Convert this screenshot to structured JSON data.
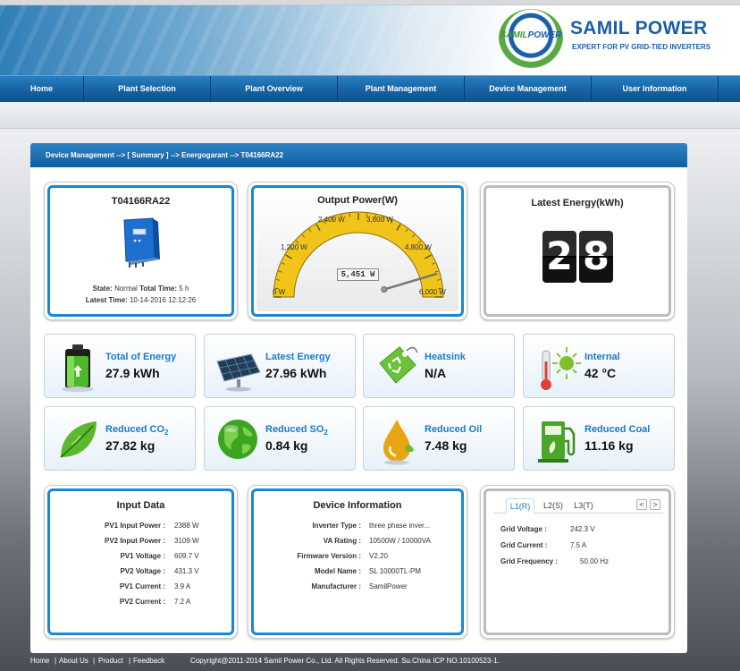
{
  "brand": {
    "circle_text_a": "SAMIL",
    "circle_text_b": "POWER",
    "title": "SAMIL POWER",
    "subtitle": "EXPERT FOR PV GRID-TIED INVERTERS"
  },
  "nav": {
    "items": [
      {
        "label": "Home"
      },
      {
        "label": "Plant Selection"
      },
      {
        "label": "Plant Overview"
      },
      {
        "label": "Plant Management"
      },
      {
        "label": "Device Management"
      },
      {
        "label": "User Information"
      }
    ]
  },
  "breadcrumb": "Device Management --> [ Summary ] --> Energogarant --> T04166RA22",
  "device": {
    "title": "T04166RA22",
    "state_label": "State:",
    "state_value": "Normal",
    "total_time_label": "Total Time:",
    "total_time_value": "5 h",
    "latest_time_label": "Latest Time:",
    "latest_time_value": "10-14-2016 12:12:26"
  },
  "output_power": {
    "title": "Output Power(W)",
    "value_text": "5,451 W",
    "value": 5451,
    "max": 6000,
    "ticks": [
      "0 W",
      "1,200 W",
      "2,400 W",
      "3,600 W",
      "4,800 W",
      "6,000 W"
    ]
  },
  "latest_energy": {
    "title": "Latest Energy(kWh)",
    "digits": [
      "2",
      "8"
    ]
  },
  "stats": [
    {
      "label": "Total of Energy",
      "value": "27.9 kWh",
      "icon": "battery-icon"
    },
    {
      "label": "Latest Energy",
      "value": "27.96 kWh",
      "icon": "solar-panel-icon"
    },
    {
      "label": "Heatsink",
      "value": "N/A",
      "icon": "recycle-tag-icon"
    },
    {
      "label": "Internal",
      "value": "42 °C",
      "icon": "thermometer-sun-icon"
    },
    {
      "label": "Reduced CO",
      "sub": "2",
      "value": "27.82 kg",
      "icon": "leaf-icon"
    },
    {
      "label": "Reduced SO",
      "sub": "2",
      "value": "0.84 kg",
      "icon": "globe-icon"
    },
    {
      "label": "Reduced Oil",
      "value": "7.48 kg",
      "icon": "oil-drop-icon"
    },
    {
      "label": "Reduced Coal",
      "value": "11.16 kg",
      "icon": "fuel-pump-icon"
    }
  ],
  "input_data": {
    "title": "Input Data",
    "rows": [
      {
        "label": "PV1 Input Power :",
        "value": "2388 W"
      },
      {
        "label": "PV2 Input Power :",
        "value": "3109 W"
      },
      {
        "label": "PV1 Voltage :",
        "value": "609.7 V"
      },
      {
        "label": "PV2 Voltage :",
        "value": "431.3 V"
      },
      {
        "label": "PV1 Current :",
        "value": "3.9 A"
      },
      {
        "label": "PV2 Current :",
        "value": "7.2 A"
      }
    ]
  },
  "device_info": {
    "title": "Device Information",
    "rows": [
      {
        "label": "Inverter Type :",
        "value": "three phase inver..."
      },
      {
        "label": "VA Rating :",
        "value": "10500W / 10000VA"
      },
      {
        "label": "Firmware Version :",
        "value": "V2.20"
      },
      {
        "label": "Model Name :",
        "value": "SL 10000TL-PM"
      },
      {
        "label": "Manufacturer :",
        "value": "SamilPower"
      }
    ]
  },
  "grid": {
    "tabs": [
      "L1(R)",
      "L2(S)",
      "L3(T)"
    ],
    "active_tab": 0,
    "prev": "<",
    "next": ">",
    "rows": [
      {
        "label": "Grid Voltage :",
        "value": "242.3 V"
      },
      {
        "label": "Grid Current :",
        "value": "7.5 A"
      },
      {
        "label": "Grid Frequency :",
        "value": "50.00 Hz"
      }
    ]
  },
  "footer": {
    "links": [
      "Home",
      "About Us",
      "Product",
      "Feedback"
    ],
    "separator": "|",
    "copyright": "Copyright@2011-2014 Samil Power Co., Ltd. All Rights Reserved. Su.China ICP NO.10100523-1."
  },
  "colors": {
    "accent": "#1b86d2",
    "nav": "#1764a6",
    "label_blue": "#1b7bc7",
    "gauge_yellow": "#f0c419"
  }
}
